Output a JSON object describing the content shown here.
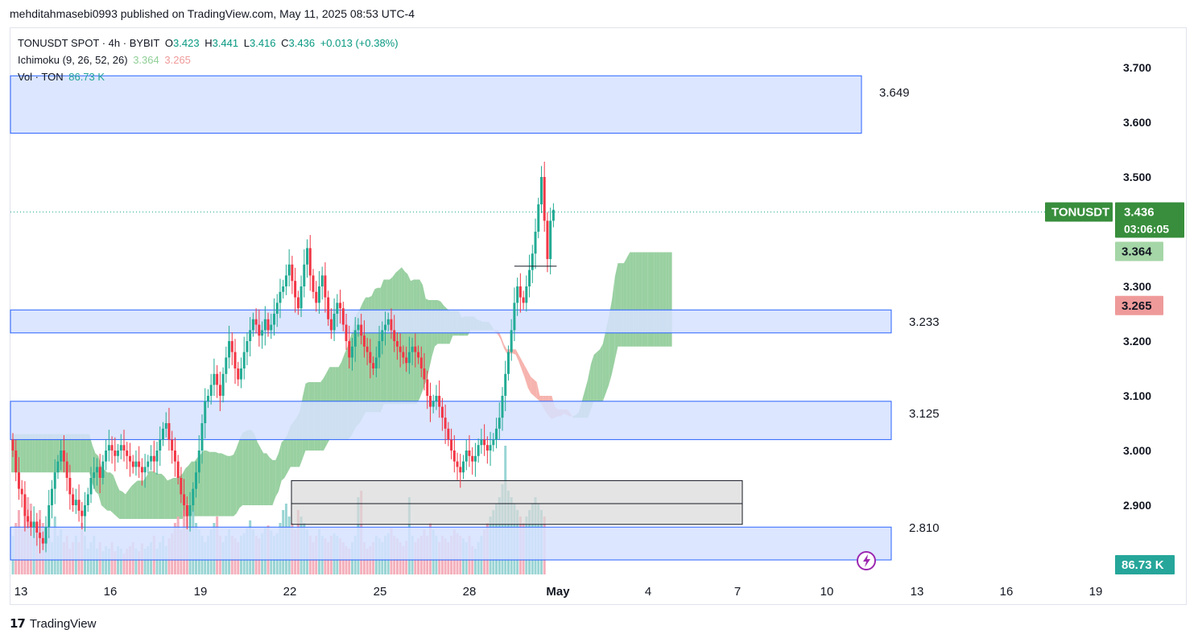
{
  "header": {
    "published": "mehditahmasebi0993 published on TradingView.com, May 11, 2025 08:53 UTC-4"
  },
  "legend": {
    "symbol": "TONUSDT SPOT · 4h · BYBIT",
    "o_label": "O",
    "o": "3.423",
    "h_label": "H",
    "h": "3.441",
    "l_label": "L",
    "l": "3.416",
    "c_label": "C",
    "c": "3.436",
    "change": "+0.013 (+0.38%)",
    "ichimoku_label": "Ichimoku (9, 26, 52, 26)",
    "ichimoku_a": "3.364",
    "ichimoku_b": "3.265",
    "vol_label": "Vol · TON",
    "vol_value": "86.73 K"
  },
  "brand": {
    "name": "TradingView"
  },
  "colors": {
    "up": "#22ab94",
    "down": "#f23645",
    "cloud_bull": "#7fc48a",
    "cloud_bear": "#f4a09a",
    "zone_fill": "#d6e2ff",
    "zone_stroke": "#2962ff",
    "gray_zone": "#d9d9d9",
    "price_tag": "#388e3c"
  },
  "chart_data": {
    "type": "candlestick",
    "symbol": "TONUSDT",
    "timeframe": "4h",
    "y_ticks": [
      3.7,
      3.6,
      3.5,
      3.3,
      3.2,
      3.1,
      3.0,
      2.9
    ],
    "y_tick_labels": [
      "3.700",
      "3.600",
      "3.500",
      "3.300",
      "3.200",
      "3.100",
      "3.000",
      "2.900"
    ],
    "ylim": [
      2.78,
      3.79
    ],
    "x_labels": [
      "13",
      "16",
      "19",
      "22",
      "25",
      "28",
      "May",
      "4",
      "7",
      "10",
      "13",
      "16",
      "19"
    ],
    "last_price": "3.436",
    "countdown": "03:06:05",
    "price_tag_symbol": "TONUSDT",
    "ichimoku_a_tag": "3.364",
    "ichimoku_b_tag": "3.265",
    "volume_tag": "86.73 K",
    "zones": [
      {
        "top": 3.685,
        "bottom": 3.58,
        "label": "3.649"
      },
      {
        "top": 3.257,
        "bottom": 3.215,
        "label": "3.233"
      },
      {
        "top": 3.09,
        "bottom": 3.02,
        "label": "3.125"
      },
      {
        "top": 2.86,
        "bottom": 2.8,
        "label": "2.810"
      }
    ],
    "gray_zone": {
      "top": 2.945,
      "mid": 2.903,
      "bottom": 2.865
    },
    "support_line": 3.337,
    "closes": [
      3.0,
      2.96,
      2.93,
      2.92,
      2.88,
      2.87,
      2.86,
      2.87,
      2.85,
      2.84,
      2.83,
      2.86,
      2.9,
      2.93,
      2.96,
      2.98,
      3.0,
      2.98,
      2.95,
      2.92,
      2.9,
      2.91,
      2.89,
      2.88,
      2.9,
      2.92,
      2.95,
      2.96,
      2.97,
      2.95,
      2.98,
      3.0,
      3.01,
      3.0,
      2.99,
      3.0,
      3.01,
      3.0,
      2.99,
      2.98,
      2.97,
      2.98,
      2.97,
      2.96,
      2.97,
      2.98,
      2.99,
      2.98,
      3.0,
      3.02,
      3.04,
      3.05,
      3.02,
      3.0,
      2.98,
      2.95,
      2.92,
      2.9,
      2.88,
      2.9,
      2.93,
      2.96,
      3.0,
      3.05,
      3.09,
      3.1,
      3.12,
      3.14,
      3.12,
      3.1,
      3.14,
      3.17,
      3.2,
      3.18,
      3.15,
      3.13,
      3.15,
      3.18,
      3.2,
      3.22,
      3.24,
      3.23,
      3.21,
      3.22,
      3.24,
      3.22,
      3.23,
      3.25,
      3.27,
      3.29,
      3.3,
      3.32,
      3.34,
      3.31,
      3.28,
      3.26,
      3.3,
      3.34,
      3.37,
      3.32,
      3.29,
      3.27,
      3.3,
      3.32,
      3.28,
      3.24,
      3.22,
      3.25,
      3.27,
      3.26,
      3.23,
      3.2,
      3.17,
      3.19,
      3.22,
      3.23,
      3.21,
      3.19,
      3.18,
      3.16,
      3.15,
      3.17,
      3.2,
      3.22,
      3.23,
      3.24,
      3.22,
      3.2,
      3.19,
      3.18,
      3.17,
      3.16,
      3.18,
      3.19,
      3.18,
      3.17,
      3.15,
      3.13,
      3.1,
      3.08,
      3.09,
      3.1,
      3.08,
      3.06,
      3.04,
      3.02,
      3.0,
      2.98,
      2.97,
      2.96,
      2.98,
      3.0,
      2.99,
      2.98,
      2.99,
      3.01,
      3.02,
      3.01,
      3.0,
      3.01,
      3.02,
      3.04,
      3.06,
      3.1,
      3.14,
      3.18,
      3.22,
      3.27,
      3.3,
      3.28,
      3.27,
      3.3,
      3.33,
      3.36,
      3.4,
      3.45,
      3.5,
      3.42,
      3.35,
      3.42,
      3.44
    ],
    "volumes": [
      0.3,
      0.4,
      0.5,
      0.35,
      0.45,
      0.6,
      0.55,
      0.4,
      0.3,
      0.5,
      0.4,
      0.35,
      0.3,
      0.25,
      0.45,
      0.3,
      0.35,
      0.25,
      0.3,
      0.2,
      0.25,
      0.3,
      0.25,
      0.4,
      0.3,
      0.2,
      0.25,
      0.3,
      0.2,
      0.25,
      0.18,
      0.22,
      0.2,
      0.25,
      0.18,
      0.22,
      0.2,
      0.16,
      0.2,
      0.22,
      0.25,
      0.2,
      0.18,
      0.24,
      0.2,
      0.22,
      0.25,
      0.3,
      0.2,
      0.25,
      0.3,
      0.22,
      0.28,
      0.32,
      0.4,
      0.45,
      0.35,
      0.5,
      0.55,
      0.45,
      0.5,
      0.4,
      0.35,
      0.3,
      0.25,
      0.3,
      0.35,
      0.4,
      0.45,
      0.3,
      0.25,
      0.3,
      0.35,
      0.3,
      0.28,
      0.25,
      0.3,
      0.32,
      0.36,
      0.42,
      0.35,
      0.3,
      0.28,
      0.32,
      0.36,
      0.38,
      0.34,
      0.3,
      0.32,
      0.4,
      0.5,
      0.55,
      0.45,
      0.4,
      0.35,
      0.5,
      0.45,
      0.4,
      0.35,
      0.3,
      0.25,
      0.3,
      0.35,
      0.3,
      0.28,
      0.25,
      0.3,
      0.32,
      0.3,
      0.28,
      0.25,
      0.22,
      0.2,
      0.25,
      0.3,
      0.6,
      0.65,
      0.25,
      0.2,
      0.22,
      0.25,
      0.3,
      0.28,
      0.25,
      0.3,
      0.32,
      0.36,
      0.3,
      0.28,
      0.25,
      0.22,
      0.26,
      0.6,
      0.3,
      0.25,
      0.28,
      0.3,
      0.35,
      0.3,
      0.4,
      0.35,
      0.3,
      0.25,
      0.3,
      0.28,
      0.25,
      0.3,
      0.35,
      0.32,
      0.3,
      0.28,
      0.25,
      0.3,
      0.22,
      0.2,
      0.25,
      0.3,
      0.35,
      0.4,
      0.45,
      0.5,
      0.55,
      0.6,
      0.7,
      1.0,
      0.65,
      0.6,
      0.55,
      0.5,
      0.45,
      0.4,
      0.45,
      0.5,
      0.55,
      0.6,
      0.55,
      0.5,
      0.45
    ]
  }
}
